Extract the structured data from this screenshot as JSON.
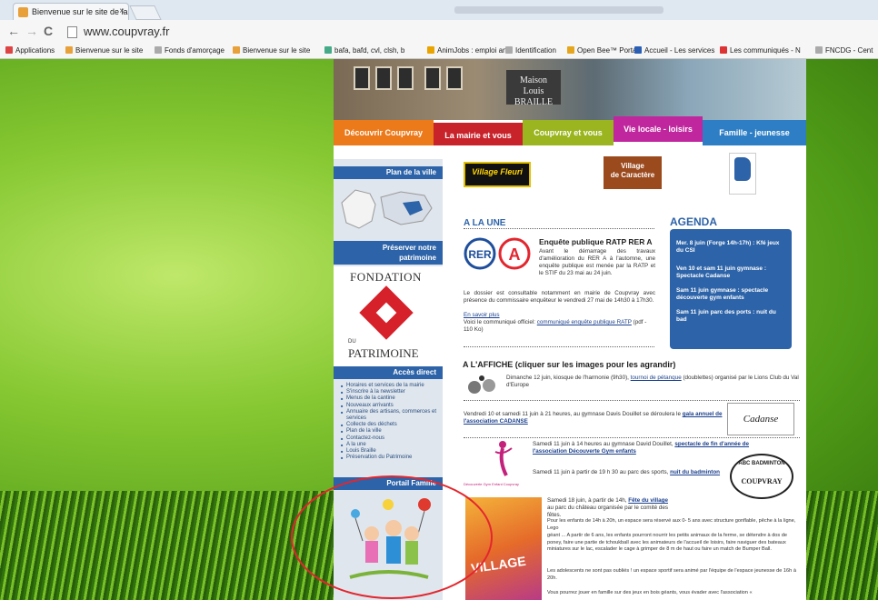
{
  "browser": {
    "tab_title": "Bienvenue sur le site de la",
    "tab_close": "×",
    "url": "www.coupvray.fr",
    "back": "←",
    "forward": "→",
    "reload": "C",
    "bookmarks": [
      {
        "label": "Applications",
        "color": "#d44"
      },
      {
        "label": "Bienvenue sur le site",
        "color": "#e8a13a"
      },
      {
        "label": "Fonds d'amorçage",
        "color": "#aaa"
      },
      {
        "label": "Bienvenue sur le site",
        "color": "#e8a13a"
      },
      {
        "label": "bafa, bafd, cvl, clsh, b",
        "color": "#4a8"
      },
      {
        "label": "AnimJobs : emploi ani",
        "color": "#e9a400"
      },
      {
        "label": "Identification",
        "color": "#aaa"
      },
      {
        "label": "Open Bee™ Portal",
        "color": "#e5a61e"
      },
      {
        "label": "Accueil - Les services",
        "color": "#2b5fb3"
      },
      {
        "label": "Les communiqués - N",
        "color": "#d33"
      },
      {
        "label": "FNCDG - Cent",
        "color": "#aaa"
      }
    ]
  },
  "banner": {
    "sign_line1": "Maison",
    "sign_line2": "Louis BRAILLE"
  },
  "menu": [
    {
      "label": "Découvrir Coupvray",
      "color": "#ec7a1b"
    },
    {
      "label": "La mairie et vous",
      "color": "#c8232b"
    },
    {
      "label": "Coupvray et vous",
      "color": "#9ab51f"
    },
    {
      "label": "Vie locale - loisirs",
      "color": "#c0269e"
    },
    {
      "label": "Famille - jeunesse",
      "color": "#2d7ec4"
    }
  ],
  "sidebar": {
    "plan_title": "Plan de la ville",
    "patrimoine_title_1": "Préserver notre",
    "patrimoine_title_2": "patrimoine",
    "fondation_1": "FONDATION",
    "fondation_du": "DU",
    "fondation_2": "PATRIMOINE",
    "acces_title": "Accès direct",
    "acces_items": [
      "Horaires et services de la mairie",
      "S'inscrire à la newsletter",
      "Menus de la cantine",
      "Nouveaux arrivants",
      "Annuaire des artisans, commerces et services",
      "Collecte des déchets",
      "Plan de la ville",
      "Contactez-nous",
      "A la une",
      "Louis Braille",
      "Préservation du Patrimoine"
    ],
    "portail_title": "Portail Famille"
  },
  "logos": {
    "village_fleuri": "Village Fleuri",
    "village_caractere_1": "Village",
    "village_caractere_2": "de Caractère"
  },
  "alaune": {
    "title": "A LA UNE",
    "rer_letters": "RER",
    "rer_a": "A",
    "heading": "Enquête publique RATP RER A",
    "p1": "Avant le démarrage des travaux d'amélioration du RER A à l'automne, une enquête publique est menée par la RATP et le STIF du 23 mai au 24 juin.",
    "p2": "Le dossier est consultable notamment en mairie de Coupvray avec présence du commissaire enquêteur le vendredi 27 mai de 14h30 à 17h30.",
    "savoir_plus": "En savoir plus",
    "p3_before": "Voici le communiqué officiel:",
    "p3_link": "communiqué enquête publique RATP",
    "p3_after": "(pdf - 110 Ko)"
  },
  "agenda": {
    "title": "AGENDA",
    "items": [
      "Mer. 8 juin (Forge 14h-17h) : Kfé jeux du CSI",
      "Ven 10 et sam 11 juin gymnase : Spectacle Cadanse",
      "Sam 11 juin gymnase : spectacle découverte gym enfants",
      "Sam 11 juin parc des ports : nuit du bad"
    ]
  },
  "affiche": {
    "title": "A L'AFFICHE (cliquer sur les images pour les agrandir)",
    "e1_text": "Dimanche 12 juin, kiosque de l'harmonie (9h30),",
    "e1_link": "tournoi de pétanque",
    "e1_rest": "(doublettes) organisé par le Lions Club du Val d'Europe",
    "e2_text": "Vendredi 10 et samedi 11 juin à 21 heures, au gymnase Davis Douillet se déroulera le",
    "e2_link": "gala annuel de l'association CADANSE",
    "cadanse_logo": "Cadanse",
    "e3_text": "Samedi 11 juin à 14 heures au gymnase David Douillet,",
    "e3_link": "spectacle de fin d'année de l'association Découverte Gym enfants",
    "gym_logo": "Découverte Gym Enfant Coupvray",
    "e4_text": "Samedi 11 juin à partir de 19 h 30 au parc des sports,",
    "e4_link": "nuit du badminton",
    "bad_logo_1": "ABC BADMINTON",
    "bad_logo_2": "COUPVRAY",
    "e5_text": "Samedi 18 juin, à partir de 14h,",
    "e5_link": "Fête du village",
    "e5_rest": "au parc du château organisée par le comité des fêtes.",
    "e5_p2": "Pour les enfants de 14h à 20h, un espace sera réservé aux 0- 5 ans avec structure gonflable, pêche à la ligne, Lego",
    "e5_p3": "géant ... A partir de 6 ans, les enfants pourront nourrir les petits animaux de la ferme, se détendre à dos de poney, faire une partie de tchoukball avec les animateurs de l'accueil de loisirs, faire naviguer des bateaux miniatures sur le lac, escalader le cage à grimper de 8 m de haut ou faire un match de Bumper Ball.",
    "e5_p4": "Les adolescents ne sont pas oubliés ! un espace sportif sera animé par l'équipe de l'espace jeunesse de 16h à 20h.",
    "e5_p5": "Vous pourrez jouer en famille sur des jeux en bois géants, vous évader avec l'association «",
    "poster_text": "VILLAGE"
  }
}
